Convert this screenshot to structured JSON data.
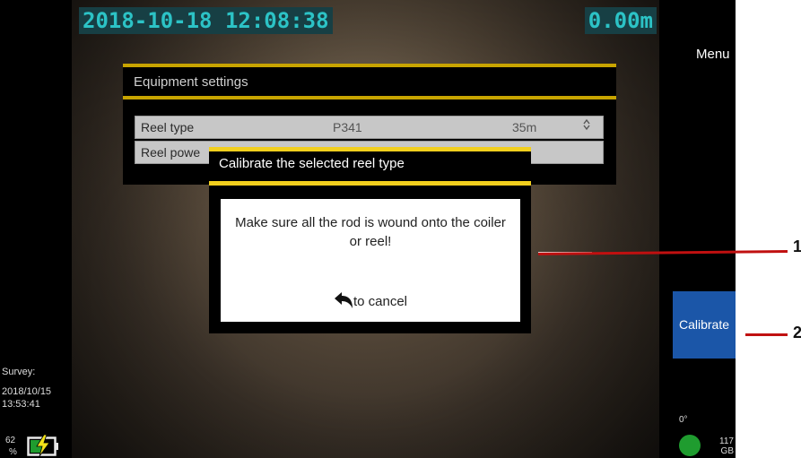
{
  "osd": {
    "datetime": "2018-10-18 12:08:38",
    "depth": "0.00m"
  },
  "equipment": {
    "title": "Equipment settings",
    "reel_type_label": "Reel type",
    "reel_type_value": "P341",
    "reel_length_value": "35m",
    "reel_power_label": "Reel powe"
  },
  "dialog": {
    "title": "Calibrate the selected reel type",
    "message": "Make sure all the rod is wound onto the coiler or reel!",
    "cancel_text": "to cancel"
  },
  "sidebar": {
    "menu_label": "Menu",
    "calibrate_label": "Calibrate"
  },
  "status": {
    "survey_label": "Survey:",
    "survey_date": "2018/10/15",
    "survey_time": "13:53:41",
    "battery_value": "62",
    "battery_unit": "%",
    "angle": "0°",
    "storage_value": "117",
    "storage_unit": "GB"
  },
  "callouts": {
    "one": "1",
    "two": "2"
  },
  "colors": {
    "osd_bg": "#173f44",
    "osd_text": "#2cc3c6",
    "accent_yellow": "#f2cf1d",
    "calibrate_blue": "#1b56a8",
    "callout_red": "#c01010",
    "status_green": "#1f9c2f"
  },
  "icons": [
    "back-arrow-icon",
    "battery-charging-icon",
    "spinner-arrows-icon"
  ]
}
